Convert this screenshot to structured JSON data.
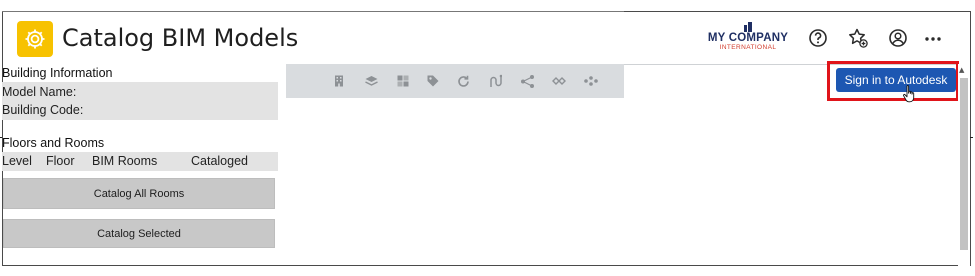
{
  "app": {
    "title": "Catalog BIM Models",
    "icon": "gear-icon",
    "accent_color": "#f7c200"
  },
  "logo": {
    "brand": "MY COMPANY",
    "tagline": "INTERNATIONAL"
  },
  "header_icons": [
    "help-icon",
    "favorites-add-icon",
    "user-account-icon",
    "more-icon"
  ],
  "building_info": {
    "title": "Building Information",
    "model_name_label": "Model Name:",
    "building_code_label": "Building Code:"
  },
  "floors_rooms": {
    "title": "Floors and Rooms",
    "columns": [
      "Level",
      "Floor",
      "BIM Rooms",
      "Cataloged"
    ],
    "catalog_all_label": "Catalog All Rooms",
    "catalog_selected_label": "Catalog Selected"
  },
  "toolbar": {
    "icons": [
      "building-icon",
      "layers-icon",
      "grid-icon",
      "tag-icon",
      "refresh-icon",
      "path-icon",
      "share-nodes-icon",
      "network-icon",
      "link-icon"
    ],
    "sign_in_label": "Sign in to Autodesk",
    "sign_in_color": "#1d57b2",
    "highlight_color": "#e0141a"
  }
}
